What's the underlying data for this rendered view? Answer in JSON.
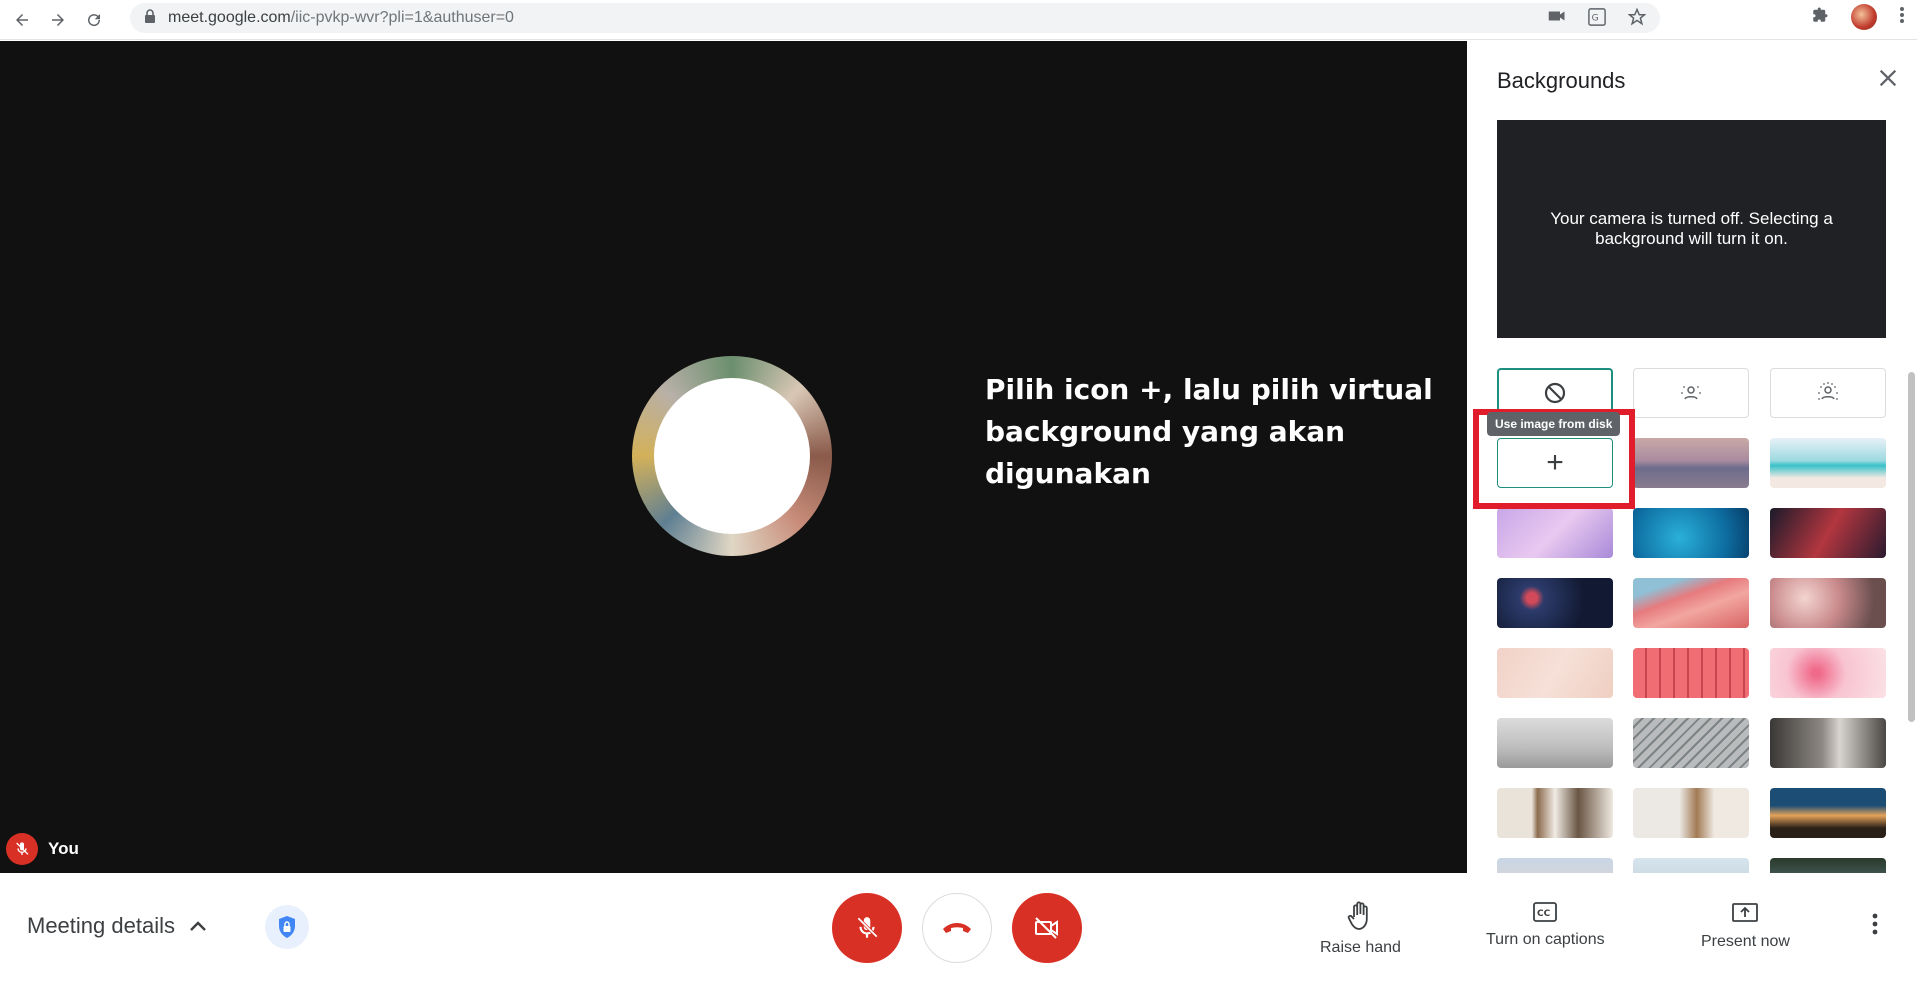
{
  "browser": {
    "url_host": "meet.google.com",
    "url_path": "/iic-pvkp-wvr?pli=1&authuser=0",
    "icons": [
      "back-icon",
      "forward-icon",
      "reload-icon",
      "lock-icon",
      "camera-icon",
      "translate-icon",
      "star-icon",
      "extensions-icon",
      "profile-avatar",
      "menu-icon"
    ]
  },
  "stage": {
    "annotation": "Pilih icon +, lalu pilih virtual background yang akan digunakan",
    "self_label": "You"
  },
  "panel": {
    "title": "Backgrounds",
    "preview_text": "Your camera is turned off. Selecting a background will turn it on.",
    "tooltip": "Use image from disk",
    "plus_label": "+",
    "colors": {
      "accent": "#1e8e7e",
      "highlight": "#e21d2b"
    }
  },
  "bottom": {
    "meeting_details": "Meeting details",
    "raise_hand": "Raise hand",
    "captions": "Turn on captions",
    "present": "Present now",
    "colors": {
      "danger": "#d93025"
    }
  }
}
